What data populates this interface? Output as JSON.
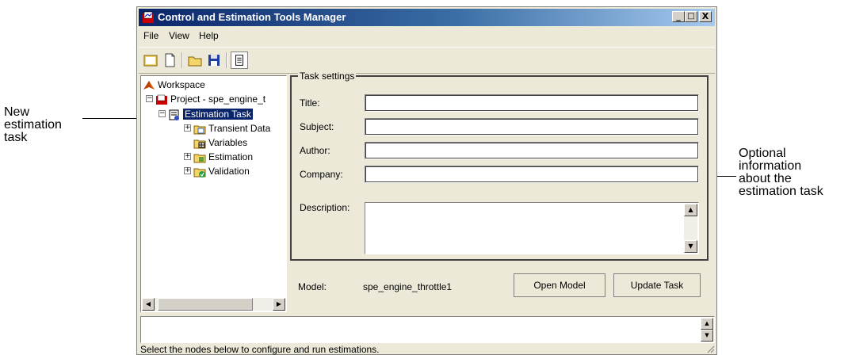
{
  "callouts": {
    "left": "New\nestimation\ntask",
    "right": "Optional\ninformation\nabout the\nestimation task"
  },
  "window": {
    "title": "Control and Estimation Tools Manager",
    "controls": {
      "minimize": "_",
      "maximize": "□",
      "close": "X"
    }
  },
  "menu": [
    "File",
    "View",
    "Help"
  ],
  "tree": {
    "workspace": "Workspace",
    "project": "Project - spe_engine_t",
    "task": "Estimation Task",
    "children": [
      "Transient Data",
      "Variables",
      "Estimation",
      "Validation"
    ]
  },
  "task_settings": {
    "legend": "Task settings",
    "fields": [
      "Title:",
      "Subject:",
      "Author:",
      "Company:"
    ],
    "description_label": "Description:"
  },
  "model": {
    "label": "Model:",
    "value": "spe_engine_throttle1"
  },
  "buttons": {
    "open_model": "Open Model",
    "update_task": "Update Task"
  },
  "status": "Select the nodes below to configure and run estimations."
}
